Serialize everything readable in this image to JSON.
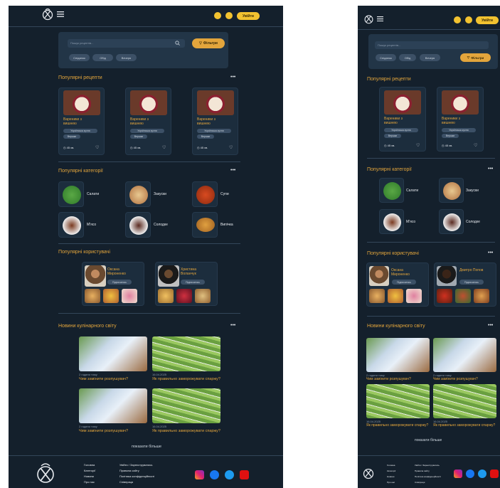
{
  "header": {
    "login_label": "Увійти"
  },
  "search": {
    "placeholder": "Пошук рецептів...",
    "filters_label": "Фільтри",
    "chips": [
      "Сніданок",
      "Обід",
      "Вечеря"
    ]
  },
  "popular_recipes": {
    "title": "Популярні рецепти",
    "more": "•••",
    "cards": [
      {
        "title": "Вареники з вишнею",
        "tags": [
          "Українська кухня",
          "Вершки"
        ],
        "time": "45 хв."
      },
      {
        "title": "Вареники з вишнею",
        "tags": [
          "Українська кухня",
          "Вершки"
        ],
        "time": "45 хв."
      },
      {
        "title": "Вареники з вишнею",
        "tags": [
          "Українська кухня",
          "Вершки"
        ],
        "time": "45 хв."
      }
    ]
  },
  "popular_categories": {
    "title": "Популярні категорії",
    "more": "•••",
    "items": [
      "Салати",
      "Закуски",
      "Супи",
      "М'ясо",
      "Солодке",
      "Випічка"
    ]
  },
  "popular_users": {
    "title": "Популярні користувачі",
    "more": "•••",
    "users": [
      {
        "name": "Оксана Мироненко",
        "follow": "Підписатись"
      },
      {
        "name": "Христина Воланчук",
        "follow": "Підписатись"
      },
      {
        "name": "Дмитро Попов",
        "follow": "Підписатись"
      }
    ]
  },
  "news": {
    "title": "Новини кулінарного світу",
    "more": "•••",
    "items": [
      {
        "time": "2 години тому",
        "title": "Чим замінити розпушувач?"
      },
      {
        "time": "16.04.2025",
        "title": "Як правильно заморожувати спаржу?"
      },
      {
        "time": "2 години тому",
        "title": "Чим замінити розпушувач?"
      },
      {
        "time": "16.04.2025",
        "title": "Як правильно заморожувати спаржу?"
      }
    ],
    "show_more": "показати більше"
  },
  "footer": {
    "col1": [
      "Головна",
      "Категорії",
      "Новини",
      "Про нас"
    ],
    "col2": [
      "Увійти / Зареєструватись",
      "Правила сайту",
      "Політика конфіденційності",
      "Співпраця"
    ]
  },
  "colors": {
    "background": "#14202c",
    "accent": "#e3a53c",
    "button": "#f2c230"
  }
}
